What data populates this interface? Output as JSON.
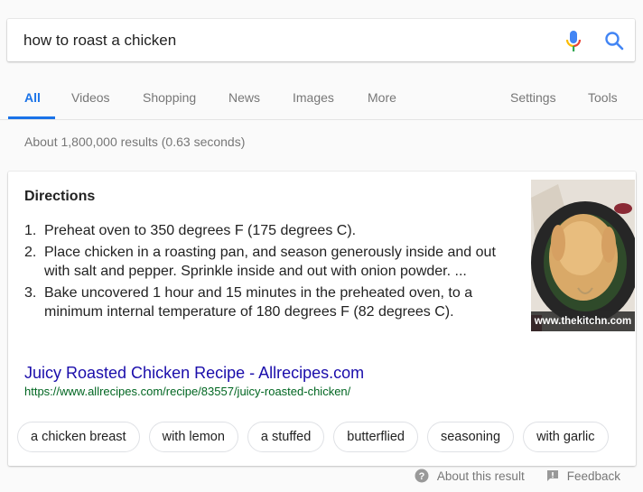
{
  "search": {
    "query": "how to roast a chicken",
    "icons": {
      "voice": "microphone-icon",
      "search": "search-icon"
    },
    "colors": {
      "search_blue": "#4285f4"
    }
  },
  "tabs": {
    "items": [
      {
        "label": "All",
        "active": true
      },
      {
        "label": "Videos"
      },
      {
        "label": "Shopping"
      },
      {
        "label": "News"
      },
      {
        "label": "Images"
      },
      {
        "label": "More"
      }
    ],
    "right": [
      {
        "label": "Settings"
      },
      {
        "label": "Tools"
      }
    ],
    "accent": "#1a73e8"
  },
  "stats": "About 1,800,000 results (0.63 seconds)",
  "featured": {
    "heading": "Directions",
    "steps": [
      {
        "num": "1.",
        "text": "Preheat oven to 350 degrees F (175 degrees C)."
      },
      {
        "num": "2.",
        "text": "Place chicken in a roasting pan, and season generously inside and out with salt and pepper. Sprinkle inside and out with onion powder. ..."
      },
      {
        "num": "3.",
        "text": "Bake uncovered 1 hour and 15 minutes in the preheated oven, to a minimum internal temperature of 180 degrees F (82 degrees C)."
      }
    ],
    "image_caption": "www.thekitchn.com",
    "result_title": "Juicy Roasted Chicken Recipe - Allrecipes.com",
    "result_url": "https://www.allrecipes.com/recipe/83557/juicy-roasted-chicken/",
    "link_color": "#1a0dab",
    "url_color": "#006621"
  },
  "chips": [
    "a chicken breast",
    "with lemon",
    "a stuffed",
    "butterflied",
    "seasoning",
    "with garlic"
  ],
  "footer": {
    "about": "About this result",
    "feedback": "Feedback"
  }
}
